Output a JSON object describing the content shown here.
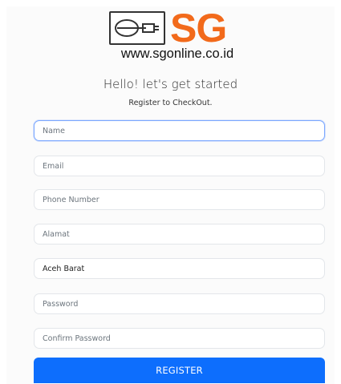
{
  "brand": {
    "logo_text": "SG",
    "url": "www.sgonline.co.id",
    "logo_color": "#f26a1b"
  },
  "header": {
    "title": "Hello! let's get started",
    "subtitle": "Register to CheckOut."
  },
  "form": {
    "name_placeholder": "Name",
    "email_placeholder": "Email",
    "phone_placeholder": "Phone Number",
    "address_placeholder": "Alamat",
    "regency_value": "Aceh Barat",
    "password_placeholder": "Password",
    "confirm_password_placeholder": "Confirm Password",
    "register_label": "REGISTER"
  },
  "colors": {
    "accent": "#0d6efd",
    "focus_border": "#7aa7ff"
  }
}
